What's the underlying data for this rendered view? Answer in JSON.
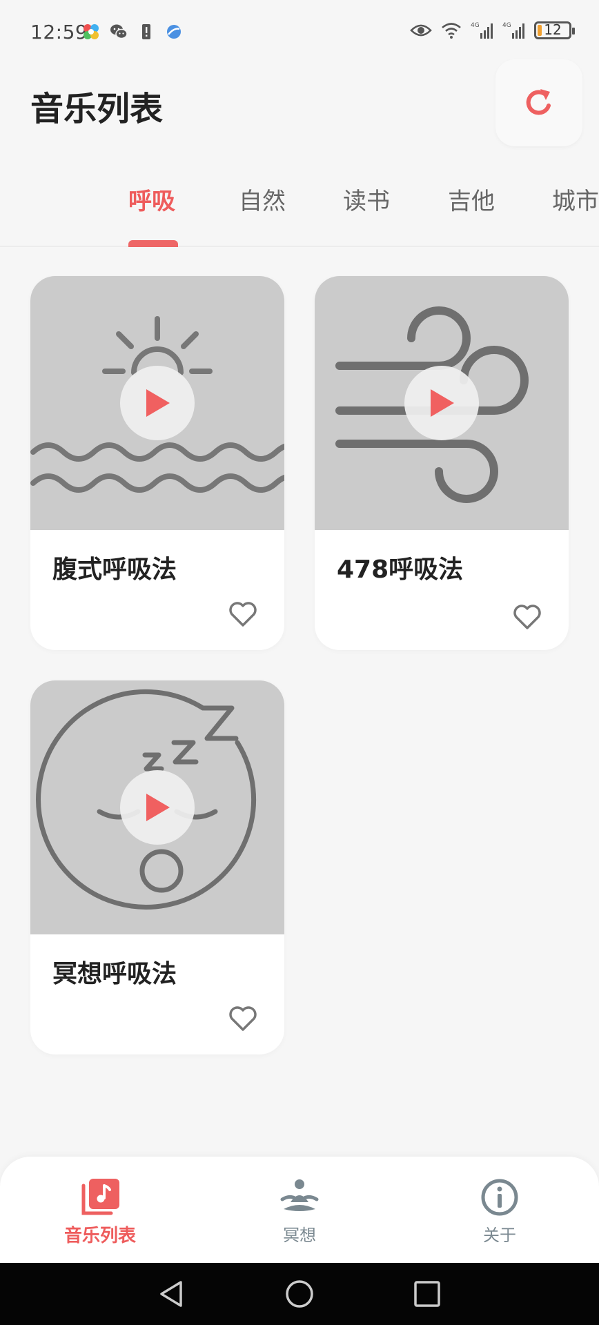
{
  "status_bar": {
    "time": "12:59",
    "left_icons": [
      "pinwheel-app-icon",
      "wechat-icon",
      "notification-alert-icon",
      "browser-icon"
    ],
    "right_icons": [
      "eye-icon",
      "wifi-icon",
      "signal-4g-icon",
      "signal-4g-icon"
    ],
    "battery_text": "12",
    "battery_level": 0.12
  },
  "header": {
    "title": "音乐列表",
    "refresh_icon": "refresh-icon",
    "accent_color": "#ee5c5c"
  },
  "tabs": [
    {
      "label": "呼吸",
      "active": true
    },
    {
      "label": "自然",
      "active": false
    },
    {
      "label": "读书",
      "active": false
    },
    {
      "label": "吉他",
      "active": false
    },
    {
      "label": "城市",
      "active": false
    }
  ],
  "cards": [
    {
      "title": "腹式呼吸法",
      "image_icon": "sunrise-waves-icon",
      "favorited": false
    },
    {
      "title": "478呼吸法",
      "image_icon": "wind-icon",
      "favorited": false
    },
    {
      "title": "冥想呼吸法",
      "image_icon": "sleeping-face-icon",
      "favorited": false
    }
  ],
  "bottom_nav": [
    {
      "label": "音乐列表",
      "icon": "music-library-icon",
      "active": true
    },
    {
      "label": "冥想",
      "icon": "meditation-icon",
      "active": false
    },
    {
      "label": "关于",
      "icon": "info-icon",
      "active": false
    }
  ],
  "system_nav": [
    "back-icon",
    "home-icon",
    "recents-icon"
  ]
}
